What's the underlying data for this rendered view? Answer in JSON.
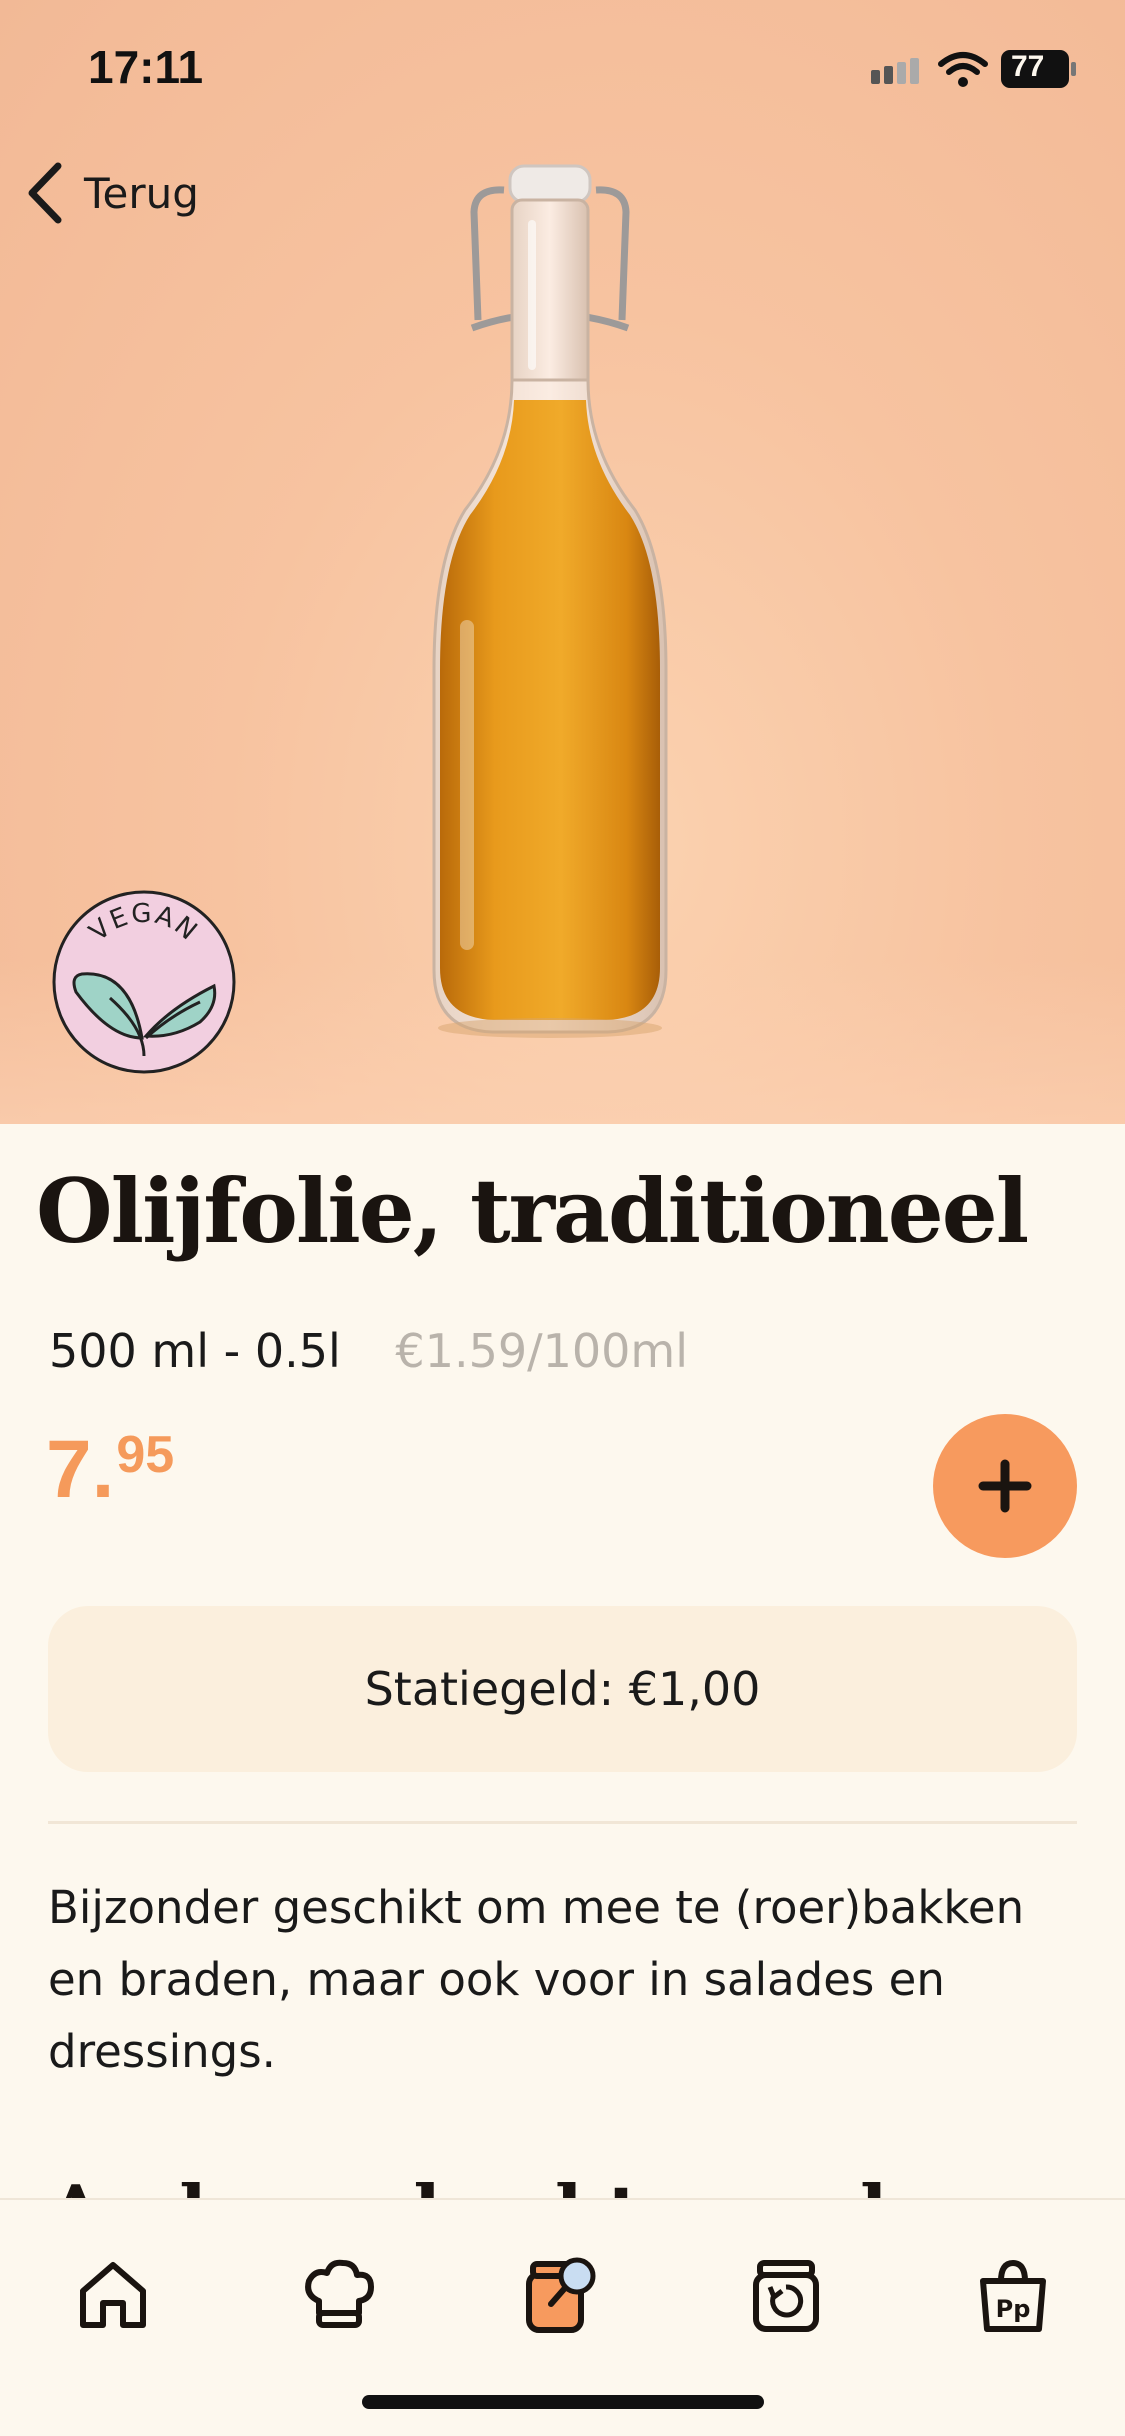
{
  "status_bar": {
    "time": "17:11",
    "battery": "77"
  },
  "nav": {
    "back_label": "Terug"
  },
  "badge": {
    "text": "VEGAN"
  },
  "product": {
    "title": "Olijfolie, traditioneel",
    "volume": "500 ml - 0.5l",
    "unit_price": "€1.59/100ml",
    "price_main": "7.",
    "price_cents": "95",
    "deposit": "Statiegeld: €1,00",
    "description": "Bijzonder geschikt om mee te (roer)bakken en braden, maar ook voor in salades en dressings."
  },
  "section": {
    "heading": "Anderen kochten ook"
  },
  "colors": {
    "accent": "#f79a5e",
    "price": "#f59a5b",
    "background": "#fdf8ee",
    "deposit_bg": "#fbefdd"
  },
  "tabs": [
    {
      "icon": "home-icon"
    },
    {
      "icon": "chef-hat-icon"
    },
    {
      "icon": "jar-search-icon"
    },
    {
      "icon": "jar-return-icon"
    },
    {
      "icon": "shopping-bag-icon"
    }
  ]
}
